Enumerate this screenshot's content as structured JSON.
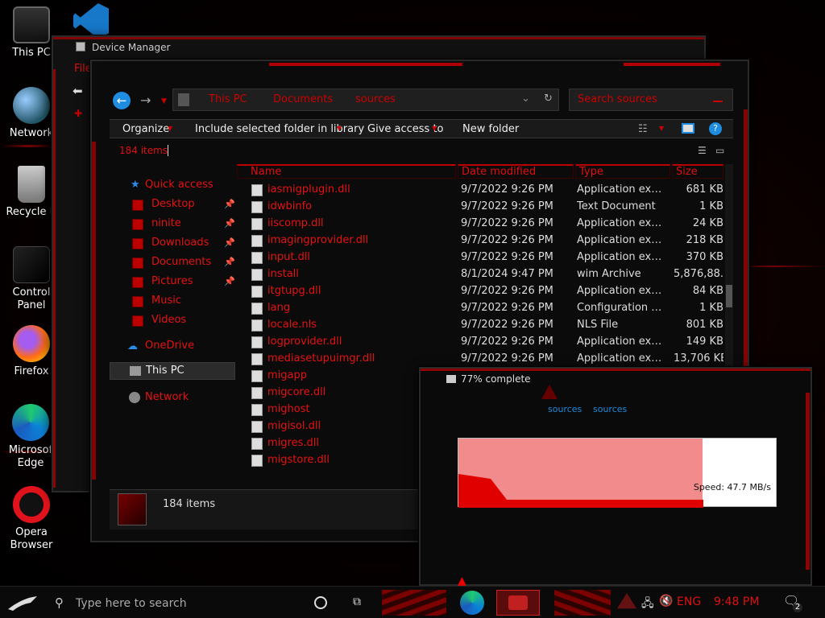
{
  "desktop": {
    "icons": [
      {
        "label": "This PC",
        "icon": "this-pc-icon"
      },
      {
        "label": "Network",
        "icon": "network-globe-icon"
      },
      {
        "label": "Recycle B",
        "icon": "recycle-bin-icon"
      },
      {
        "label": "Control Panel",
        "icon": "control-panel-icon"
      },
      {
        "label": "Firefox",
        "icon": "firefox-icon"
      },
      {
        "label": "Microsof Edge",
        "icon": "edge-icon"
      },
      {
        "label": "Opera Browser",
        "icon": "opera-icon"
      }
    ]
  },
  "device_manager": {
    "title": "Device Manager",
    "menu_file": "File"
  },
  "explorer": {
    "breadcrumb": [
      "This PC",
      "Documents",
      "sources"
    ],
    "search_placeholder": "Search sources",
    "toolbar": {
      "organize": "Organize",
      "include": "Include selected folder in library",
      "share": "Give access to",
      "new_folder": "New folder"
    },
    "item_count": "184 items",
    "columns": {
      "name": "Name",
      "date": "Date modified",
      "type": "Type",
      "size": "Size"
    },
    "nav": {
      "quick_access": "Quick access",
      "items": [
        {
          "label": "Desktop",
          "pinned": "📌"
        },
        {
          "label": "ninite",
          "pinned": "📌"
        },
        {
          "label": "Downloads",
          "pinned": "📌"
        },
        {
          "label": "Documents",
          "pinned": "📌"
        },
        {
          "label": "Pictures",
          "pinned": "📌"
        },
        {
          "label": "Music",
          "pinned": ""
        },
        {
          "label": "Videos",
          "pinned": ""
        }
      ],
      "onedrive": "OneDrive",
      "this_pc": "This PC",
      "network": "Network"
    },
    "files": [
      {
        "name": "iasmigplugin.dll",
        "date": "9/7/2022 9:26 PM",
        "type": "Application exte...",
        "size": "681 KB"
      },
      {
        "name": "idwbinfo",
        "date": "9/7/2022 9:26 PM",
        "type": "Text Document",
        "size": "1 KB"
      },
      {
        "name": "iiscomp.dll",
        "date": "9/7/2022 9:26 PM",
        "type": "Application exte...",
        "size": "24 KB"
      },
      {
        "name": "imagingprovider.dll",
        "date": "9/7/2022 9:26 PM",
        "type": "Application exte...",
        "size": "218 KB"
      },
      {
        "name": "input.dll",
        "date": "9/7/2022 9:26 PM",
        "type": "Application exte...",
        "size": "370 KB"
      },
      {
        "name": "install",
        "date": "8/1/2024 9:47 PM",
        "type": "wim Archive",
        "size": "5,876,88..."
      },
      {
        "name": "itgtupg.dll",
        "date": "9/7/2022 9:26 PM",
        "type": "Application exte...",
        "size": "84 KB"
      },
      {
        "name": "lang",
        "date": "9/7/2022 9:26 PM",
        "type": "Configuration se...",
        "size": "1 KB"
      },
      {
        "name": "locale.nls",
        "date": "9/7/2022 9:26 PM",
        "type": "NLS File",
        "size": "801 KB"
      },
      {
        "name": "logprovider.dll",
        "date": "9/7/2022 9:26 PM",
        "type": "Application exte...",
        "size": "149 KB"
      },
      {
        "name": "mediasetupuimgr.dll",
        "date": "9/7/2022 9:26 PM",
        "type": "Application exte...",
        "size": "13,706 KB"
      },
      {
        "name": "migapp",
        "date": "",
        "type": "",
        "size": ""
      },
      {
        "name": "migcore.dll",
        "date": "",
        "type": "",
        "size": ""
      },
      {
        "name": "mighost",
        "date": "",
        "type": "",
        "size": ""
      },
      {
        "name": "migisol.dll",
        "date": "",
        "type": "",
        "size": ""
      },
      {
        "name": "migres.dll",
        "date": "",
        "type": "",
        "size": ""
      },
      {
        "name": "migstore.dll",
        "date": "",
        "type": "",
        "size": ""
      }
    ],
    "details_count": "184 items"
  },
  "copy_dialog": {
    "title": "77% complete",
    "progress_fraction": 0.77,
    "from": "sources",
    "to": "sources",
    "speed": "Speed: 47.7 MB/s"
  },
  "taskbar": {
    "search_placeholder": "Type here to search",
    "lang": "ENG",
    "time": "9:48 PM",
    "notif_count": "2"
  },
  "colors": {
    "accent": "#e01010",
    "frame": "#b00000"
  }
}
